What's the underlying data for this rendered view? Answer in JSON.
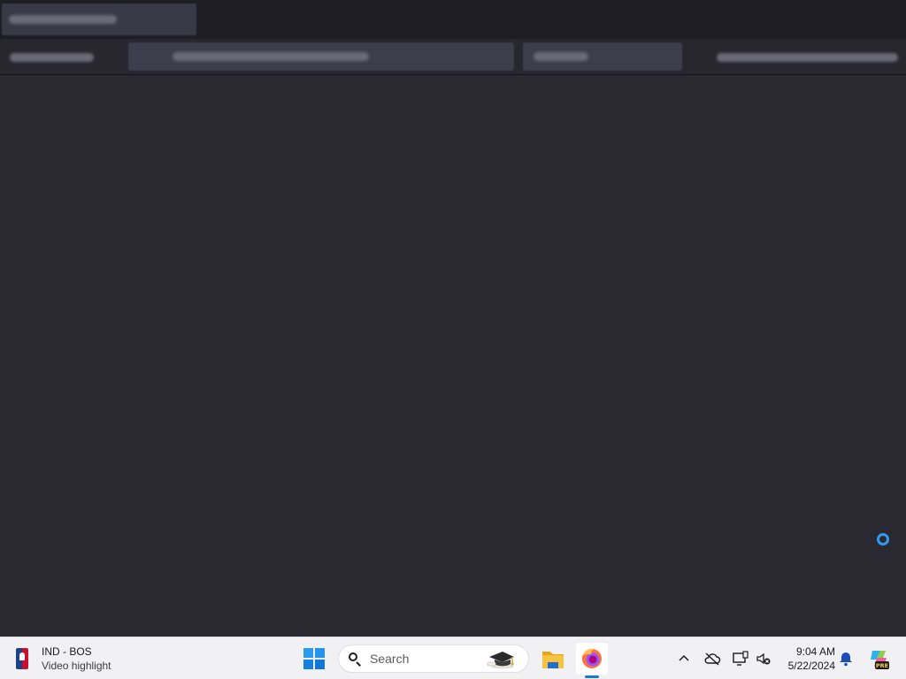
{
  "taskbar": {
    "widget": {
      "title": "IND - BOS",
      "subtitle": "Video highlight",
      "icon": "nba-logo-icon"
    },
    "search": {
      "placeholder": "Search"
    },
    "apps": [
      {
        "name": "File Explorer",
        "icon": "folder-icon"
      },
      {
        "name": "Firefox",
        "icon": "firefox-icon",
        "active": true
      }
    ],
    "tray": {
      "icons": [
        "chevron-up-icon",
        "cloud-off-icon",
        "network-icon",
        "volume-muted-icon",
        "bell-icon",
        "copilot-icon"
      ],
      "time": "9:04 AM",
      "date": "5/22/2024"
    }
  },
  "colors": {
    "window_bg": "#2a2931",
    "titlebar_bg": "#1e1d23",
    "taskbar_bg": "#f1f0f2",
    "accent": "#1a8fe3",
    "spinner": "#2f9bf0"
  }
}
